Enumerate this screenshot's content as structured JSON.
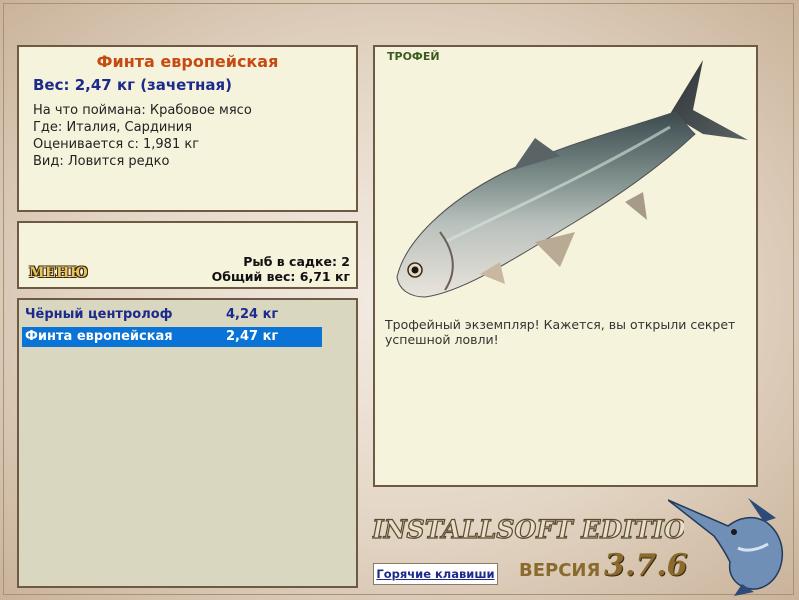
{
  "catch": {
    "fish_name": "Финта европейская",
    "weight_line": "Вес: 2,47 кг (зачетная)",
    "details": [
      {
        "label": "На что поймана:",
        "value": "Крабовое мясо"
      },
      {
        "label": "Где:",
        "value": "Италия, Сардиния"
      },
      {
        "label": "Оценивается с:",
        "value": "1,981 кг"
      },
      {
        "label": "Вид:",
        "value": "Ловится редко"
      }
    ]
  },
  "status": {
    "menu_label": "МЕНЮ",
    "fish_in_net": "Рыб в садке: 2",
    "total_weight": "Общий вес: 6,71 кг"
  },
  "fish_list": [
    {
      "name": "Чёрный центролоф",
      "weight": "4,24 кг",
      "selected": false
    },
    {
      "name": "Финта европейская",
      "weight": "2,47 кг",
      "selected": true
    }
  ],
  "trophy": {
    "label": "ТРОФЕЙ",
    "description": "Трофейный экземпляр! Кажется, вы открыли секрет успешной ловли!"
  },
  "branding": {
    "edition": "INSTALLSOFT EDITION",
    "version_label": "ВЕРСИЯ",
    "version_number": "3.7.6"
  },
  "hotkeys_label": "Горячие клавиши",
  "icons": {
    "fish_image": "shad-fish-image",
    "logo": "marlin-logo"
  }
}
